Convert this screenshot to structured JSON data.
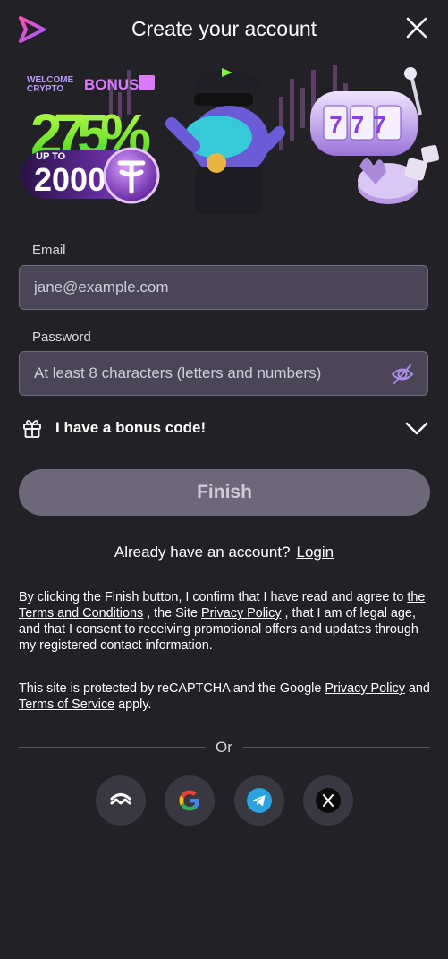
{
  "header": {
    "title": "Create your account"
  },
  "banner": {
    "welcome": "WELCOME",
    "crypto": "CRYPTO",
    "bonus": "BONUS",
    "percent": "275%",
    "up_to": "UP TO",
    "amount": "2000",
    "slot_digits": "777"
  },
  "form": {
    "email_label": "Email",
    "email_placeholder": "jane@example.com",
    "password_label": "Password",
    "password_placeholder": "At least 8 characters (letters and numbers)",
    "bonus_code": "I have a bonus code!",
    "finish": "Finish"
  },
  "login_prompt": {
    "text": "Already have an account?",
    "link": "Login"
  },
  "legal": {
    "p1_a": "By clicking the Finish button, I confirm that I have read and agree to ",
    "terms": "the Terms and Conditions",
    "p1_b": " , the Site ",
    "privacy": "Privacy Policy",
    "p1_c": " , that I am of legal age, and that I consent to receiving promotional offers and updates through my registered contact information.",
    "p2_a": "This site is protected by reCAPTCHA and the Google ",
    "google_privacy": "Privacy Policy",
    "p2_b": " and ",
    "tos": "Terms of Service",
    "p2_c": " apply."
  },
  "divider_text": "Or",
  "social": [
    {
      "icon": "walletconnect-icon"
    },
    {
      "icon": "google-icon"
    },
    {
      "icon": "telegram-icon"
    },
    {
      "icon": "x-icon"
    }
  ],
  "colors": {
    "background": "#222125",
    "input_bg": "#4a4658",
    "button_bg": "#6d6879",
    "accent_green": "#7cf23a",
    "accent_purple": "#b166ff"
  }
}
